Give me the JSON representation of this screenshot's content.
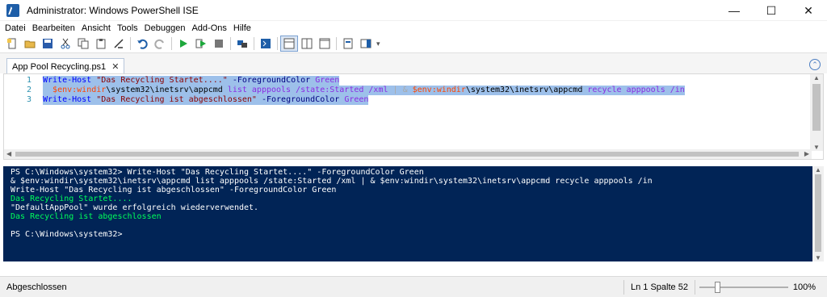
{
  "window": {
    "title": "Administrator: Windows PowerShell ISE"
  },
  "menu": [
    "Datei",
    "Bearbeiten",
    "Ansicht",
    "Tools",
    "Debuggen",
    "Add-Ons",
    "Hilfe"
  ],
  "tab": {
    "label": "App Pool Recycling.ps1",
    "close": "✕"
  },
  "script": {
    "line_numbers": [
      "1",
      "2",
      "3"
    ],
    "lines": [
      [
        {
          "t": "Write-Host",
          "c": "c-cmd"
        },
        {
          "t": " ",
          "c": "c-txt"
        },
        {
          "t": "\"Das Recycling Startet....\"",
          "c": "c-str"
        },
        {
          "t": " ",
          "c": "c-txt"
        },
        {
          "t": "-ForegroundColor",
          "c": "c-par"
        },
        {
          "t": " ",
          "c": "c-txt"
        },
        {
          "t": "Green",
          "c": "c-arg"
        }
      ],
      [
        {
          "t": "  ",
          "c": "c-txt"
        },
        {
          "t": "$env:windir",
          "c": "c-var"
        },
        {
          "t": "\\system32\\inetsrv\\appcmd",
          "c": "c-txt"
        },
        {
          "t": " list apppools /state:Started /xml ",
          "c": "c-arg"
        },
        {
          "t": "|",
          "c": "c-op"
        },
        {
          "t": " ",
          "c": "c-txt"
        },
        {
          "t": "&",
          "c": "c-op"
        },
        {
          "t": " ",
          "c": "c-txt"
        },
        {
          "t": "$env:windir",
          "c": "c-var"
        },
        {
          "t": "\\system32\\inetsrv\\appcmd",
          "c": "c-txt"
        },
        {
          "t": " recycle apppools /in",
          "c": "c-arg"
        }
      ],
      [
        {
          "t": "Write-Host",
          "c": "c-cmd"
        },
        {
          "t": " ",
          "c": "c-txt"
        },
        {
          "t": "\"Das Recycling ist abgeschlossen\"",
          "c": "c-str"
        },
        {
          "t": " ",
          "c": "c-txt"
        },
        {
          "t": "-ForegroundColor",
          "c": "c-par"
        },
        {
          "t": " ",
          "c": "c-txt"
        },
        {
          "t": "Green",
          "c": "c-arg"
        }
      ]
    ]
  },
  "console": {
    "lines": [
      {
        "text": "PS C:\\Windows\\system32> Write-Host \"Das Recycling Startet....\" -ForegroundColor Green",
        "green": false
      },
      {
        "text": "& $env:windir\\system32\\inetsrv\\appcmd list apppools /state:Started /xml | & $env:windir\\system32\\inetsrv\\appcmd recycle apppools /in",
        "green": false
      },
      {
        "text": "Write-Host \"Das Recycling ist abgeschlossen\" -ForegroundColor Green",
        "green": false
      },
      {
        "text": "Das Recycling Startet....",
        "green": true
      },
      {
        "text": "\"DefaultAppPool\" wurde erfolgreich wiederverwendet.",
        "green": false
      },
      {
        "text": "Das Recycling ist abgeschlossen",
        "green": true
      },
      {
        "text": "",
        "green": false
      },
      {
        "text": "PS C:\\Windows\\system32>",
        "green": false
      }
    ]
  },
  "status": {
    "text": "Abgeschlossen",
    "position": "Ln 1  Spalte 52",
    "zoom": "100%",
    "zoom_fraction": 0.2
  },
  "colors": {
    "console_bg": "#012456",
    "selection": "#9dc0ea",
    "console_green": "#00ff5a"
  }
}
